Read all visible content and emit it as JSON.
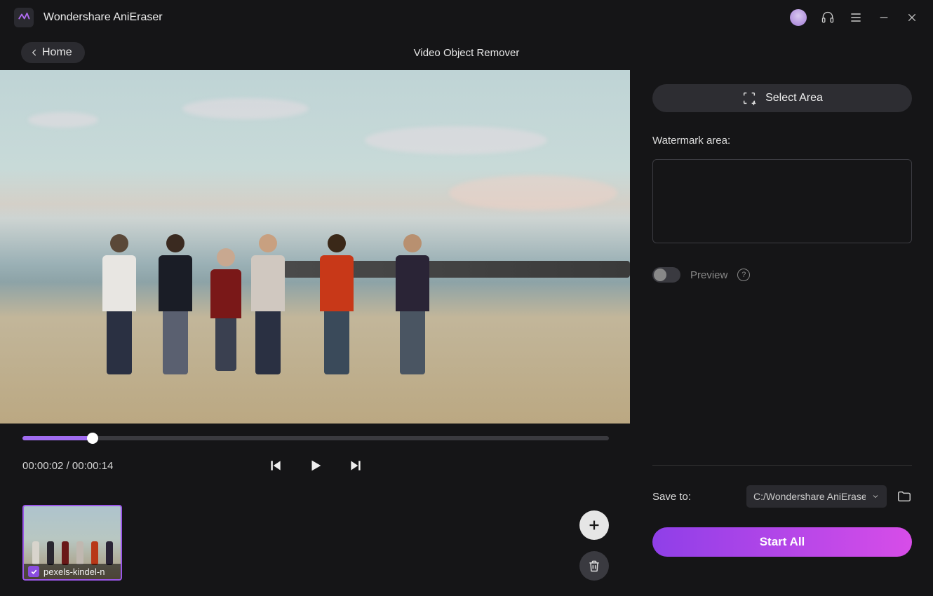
{
  "app": {
    "title": "Wondershare AniEraser"
  },
  "nav": {
    "back_label": "Home",
    "page_title": "Video Object Remover"
  },
  "playback": {
    "current_time": "00:00:02",
    "duration": "00:00:14",
    "progress_pct": 12
  },
  "thumbnail": {
    "filename": "pexels-kindel-n"
  },
  "rightpane": {
    "select_area_label": "Select Area",
    "watermark_label": "Watermark area:",
    "preview_label": "Preview",
    "saveto_label": "Save to:",
    "save_path": "C:/Wondershare AniEraser/V",
    "start_label": "Start All"
  }
}
